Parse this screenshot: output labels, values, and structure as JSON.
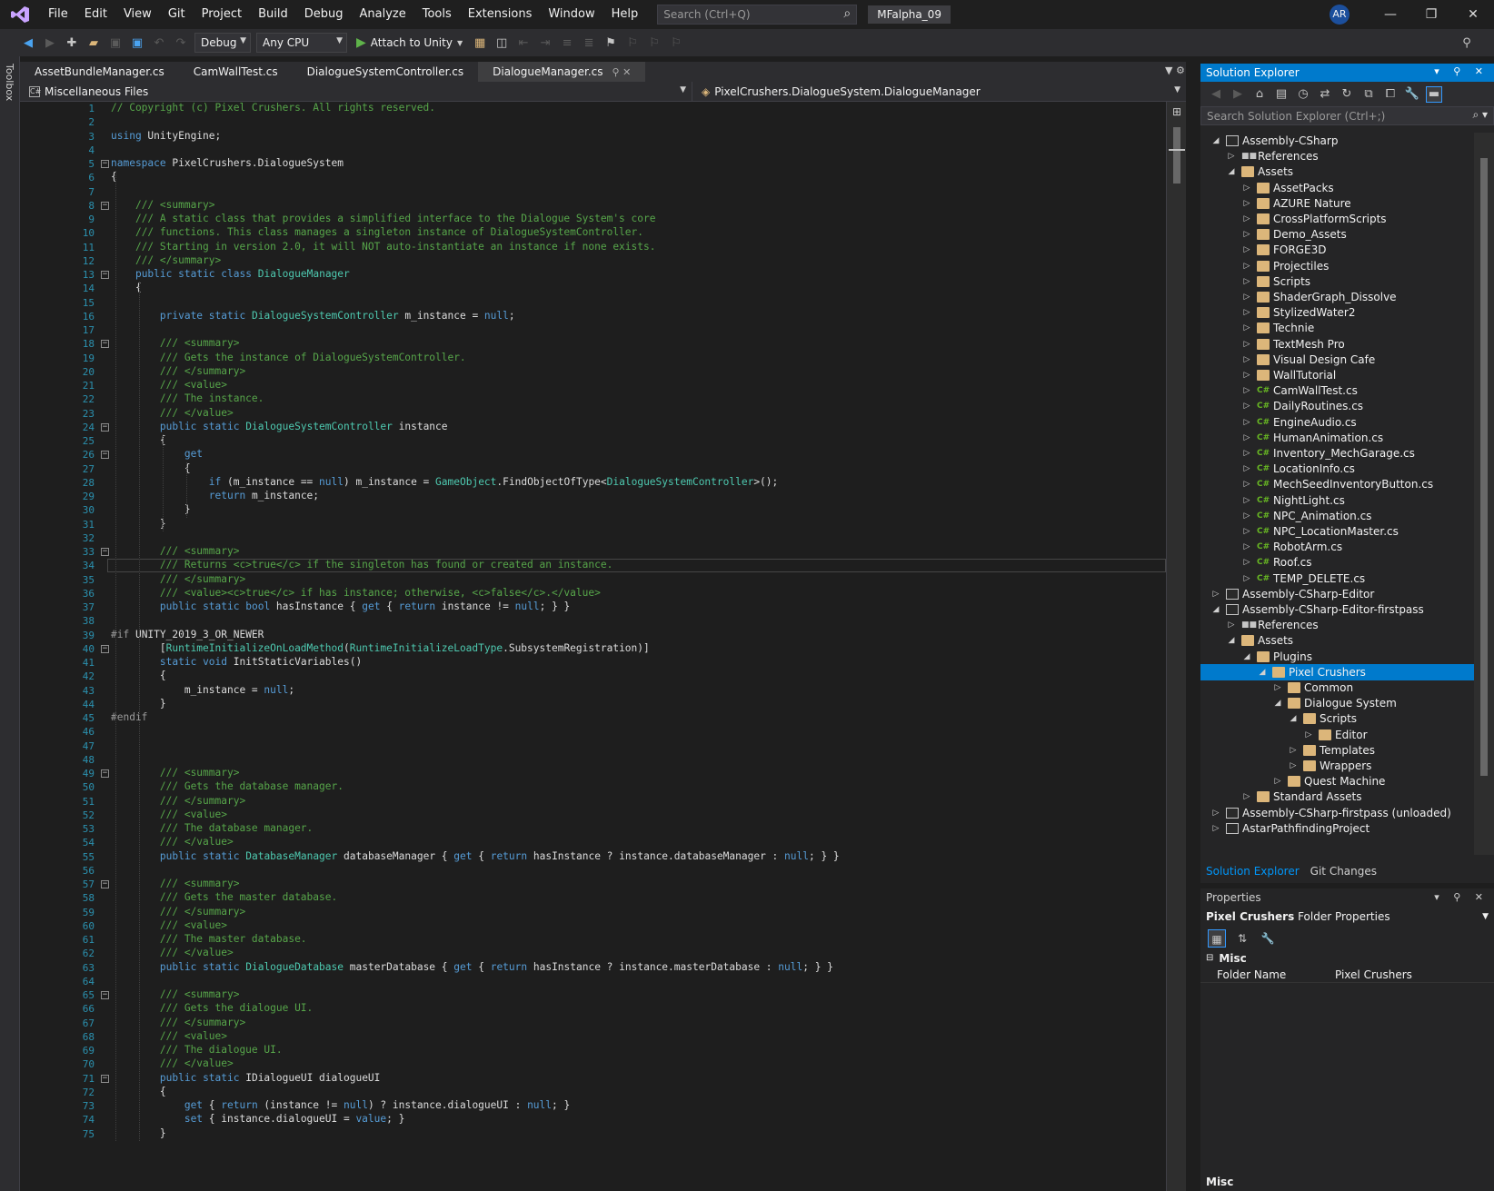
{
  "menubar": {
    "items": [
      "File",
      "Edit",
      "View",
      "Git",
      "Project",
      "Build",
      "Debug",
      "Analyze",
      "Tools",
      "Extensions",
      "Window",
      "Help"
    ],
    "search_placeholder": "Search (Ctrl+Q)",
    "solution_name": "MFalpha_09",
    "user_initials": "AR"
  },
  "toolbar": {
    "config": "Debug",
    "platform": "Any CPU",
    "attach_label": "Attach to Unity"
  },
  "toolbox_label": "Toolbox",
  "tabs": [
    {
      "label": "AssetBundleManager.cs",
      "active": false
    },
    {
      "label": "CamWallTest.cs",
      "active": false
    },
    {
      "label": "DialogueSystemController.cs",
      "active": false
    },
    {
      "label": "DialogueManager.cs",
      "active": true
    }
  ],
  "navbar": {
    "project": "Miscellaneous Files",
    "type": "PixelCrushers.DialogueSystem.DialogueManager"
  },
  "code_lines": [
    "// Copyright (c) Pixel Crushers. All rights reserved.",
    "",
    "using UnityEngine;",
    "",
    "namespace PixelCrushers.DialogueSystem",
    "{",
    "",
    "    /// <summary>",
    "    /// A static class that provides a simplified interface to the Dialogue System's core",
    "    /// functions. This class manages a singleton instance of DialogueSystemController.",
    "    /// Starting in version 2.0, it will NOT auto-instantiate an instance if none exists.",
    "    /// </summary>",
    "    public static class DialogueManager",
    "    {",
    "",
    "        private static DialogueSystemController m_instance = null;",
    "",
    "        /// <summary>",
    "        /// Gets the instance of DialogueSystemController.",
    "        /// </summary>",
    "        /// <value>",
    "        /// The instance.",
    "        /// </value>",
    "        public static DialogueSystemController instance",
    "        {",
    "            get",
    "            {",
    "                if (m_instance == null) m_instance = GameObject.FindObjectOfType<DialogueSystemController>();",
    "                return m_instance;",
    "            }",
    "        }",
    "",
    "        /// <summary>",
    "        /// Returns <c>true</c> if the singleton has found or created an instance.",
    "        /// </summary>",
    "        /// <value><c>true</c> if has instance; otherwise, <c>false</c>.</value>",
    "        public static bool hasInstance { get { return instance != null; } }",
    "",
    "#if UNITY_2019_3_OR_NEWER",
    "        [RuntimeInitializeOnLoadMethod(RuntimeInitializeLoadType.SubsystemRegistration)]",
    "        static void InitStaticVariables()",
    "        {",
    "            m_instance = null;",
    "        }",
    "#endif",
    "",
    "",
    "",
    "        /// <summary>",
    "        /// Gets the database manager.",
    "        /// </summary>",
    "        /// <value>",
    "        /// The database manager.",
    "        /// </value>",
    "        public static DatabaseManager databaseManager { get { return hasInstance ? instance.databaseManager : null; } }",
    "",
    "        /// <summary>",
    "        /// Gets the master database.",
    "        /// </summary>",
    "        /// <value>",
    "        /// The master database.",
    "        /// </value>",
    "        public static DialogueDatabase masterDatabase { get { return hasInstance ? instance.masterDatabase : null; } }",
    "",
    "        /// <summary>",
    "        /// Gets the dialogue UI.",
    "        /// </summary>",
    "        /// <value>",
    "        /// The dialogue UI.",
    "        /// </value>",
    "        public static IDialogueUI dialogueUI",
    "        {",
    "            get { return (instance != null) ? instance.dialogueUI : null; }",
    "            set { instance.dialogueUI = value; }",
    "        }"
  ],
  "fold_lines": [
    5,
    8,
    13,
    18,
    24,
    26,
    33,
    40,
    49,
    57,
    65,
    71
  ],
  "current_line": 34,
  "solution_explorer": {
    "title": "Solution Explorer",
    "search_placeholder": "Search Solution Explorer (Ctrl+;)",
    "items": [
      {
        "label": "Assembly-CSharp",
        "level": 0,
        "icon": "proj",
        "exp": "open"
      },
      {
        "label": "References",
        "level": 1,
        "icon": "refs",
        "exp": "closed"
      },
      {
        "label": "Assets",
        "level": 1,
        "icon": "ofolder",
        "exp": "open"
      },
      {
        "label": "AssetPacks",
        "level": 2,
        "icon": "folder",
        "exp": "closed"
      },
      {
        "label": "AZURE Nature",
        "level": 2,
        "icon": "folder",
        "exp": "closed"
      },
      {
        "label": "CrossPlatformScripts",
        "level": 2,
        "icon": "folder",
        "exp": "closed"
      },
      {
        "label": "Demo_Assets",
        "level": 2,
        "icon": "folder",
        "exp": "closed"
      },
      {
        "label": "FORGE3D",
        "level": 2,
        "icon": "folder",
        "exp": "closed"
      },
      {
        "label": "Projectiles",
        "level": 2,
        "icon": "folder",
        "exp": "closed"
      },
      {
        "label": "Scripts",
        "level": 2,
        "icon": "folder",
        "exp": "closed"
      },
      {
        "label": "ShaderGraph_Dissolve",
        "level": 2,
        "icon": "folder",
        "exp": "closed"
      },
      {
        "label": "StylizedWater2",
        "level": 2,
        "icon": "folder",
        "exp": "closed"
      },
      {
        "label": "Technie",
        "level": 2,
        "icon": "folder",
        "exp": "closed"
      },
      {
        "label": "TextMesh Pro",
        "level": 2,
        "icon": "folder",
        "exp": "closed"
      },
      {
        "label": "Visual Design Cafe",
        "level": 2,
        "icon": "folder",
        "exp": "closed"
      },
      {
        "label": "WallTutorial",
        "level": 2,
        "icon": "folder",
        "exp": "closed"
      },
      {
        "label": "CamWallTest.cs",
        "level": 2,
        "icon": "cs",
        "exp": "closed"
      },
      {
        "label": "DailyRoutines.cs",
        "level": 2,
        "icon": "cs",
        "exp": "closed"
      },
      {
        "label": "EngineAudio.cs",
        "level": 2,
        "icon": "cs",
        "exp": "closed"
      },
      {
        "label": "HumanAnimation.cs",
        "level": 2,
        "icon": "cs",
        "exp": "closed"
      },
      {
        "label": "Inventory_MechGarage.cs",
        "level": 2,
        "icon": "cs",
        "exp": "closed"
      },
      {
        "label": "LocationInfo.cs",
        "level": 2,
        "icon": "cs",
        "exp": "closed"
      },
      {
        "label": "MechSeedInventoryButton.cs",
        "level": 2,
        "icon": "cs",
        "exp": "closed"
      },
      {
        "label": "NightLight.cs",
        "level": 2,
        "icon": "cs",
        "exp": "closed"
      },
      {
        "label": "NPC_Animation.cs",
        "level": 2,
        "icon": "cs",
        "exp": "closed"
      },
      {
        "label": "NPC_LocationMaster.cs",
        "level": 2,
        "icon": "cs",
        "exp": "closed"
      },
      {
        "label": "RobotArm.cs",
        "level": 2,
        "icon": "cs",
        "exp": "closed"
      },
      {
        "label": "Roof.cs",
        "level": 2,
        "icon": "cs",
        "exp": "closed"
      },
      {
        "label": "TEMP_DELETE.cs",
        "level": 2,
        "icon": "cs",
        "exp": "closed"
      },
      {
        "label": "Assembly-CSharp-Editor",
        "level": 0,
        "icon": "proj",
        "exp": "closed"
      },
      {
        "label": "Assembly-CSharp-Editor-firstpass",
        "level": 0,
        "icon": "proj",
        "exp": "open"
      },
      {
        "label": "References",
        "level": 1,
        "icon": "refs",
        "exp": "closed"
      },
      {
        "label": "Assets",
        "level": 1,
        "icon": "ofolder",
        "exp": "open"
      },
      {
        "label": "Plugins",
        "level": 2,
        "icon": "ofolder",
        "exp": "open"
      },
      {
        "label": "Pixel Crushers",
        "level": 3,
        "icon": "ofolder",
        "exp": "open",
        "selected": true
      },
      {
        "label": "Common",
        "level": 4,
        "icon": "folder",
        "exp": "closed"
      },
      {
        "label": "Dialogue System",
        "level": 4,
        "icon": "ofolder",
        "exp": "open"
      },
      {
        "label": "Scripts",
        "level": 5,
        "icon": "ofolder",
        "exp": "open"
      },
      {
        "label": "Editor",
        "level": 6,
        "icon": "folder",
        "exp": "closed"
      },
      {
        "label": "Templates",
        "level": 5,
        "icon": "folder",
        "exp": "closed"
      },
      {
        "label": "Wrappers",
        "level": 5,
        "icon": "folder",
        "exp": "closed"
      },
      {
        "label": "Quest Machine",
        "level": 4,
        "icon": "folder",
        "exp": "closed"
      },
      {
        "label": "Standard Assets",
        "level": 2,
        "icon": "folder",
        "exp": "closed"
      },
      {
        "label": "Assembly-CSharp-firstpass (unloaded)",
        "level": 0,
        "icon": "proj",
        "exp": "closed"
      },
      {
        "label": "AstarPathfindingProject",
        "level": 0,
        "icon": "proj",
        "exp": "closed"
      }
    ],
    "bottom_tabs": [
      "Solution Explorer",
      "Git Changes"
    ]
  },
  "properties": {
    "title": "Properties",
    "object_name": "Pixel Crushers",
    "object_type": "Folder Properties",
    "category": "Misc",
    "row_name": "Folder Name",
    "row_value": "Pixel Crushers",
    "footer": "Misc"
  },
  "colors": {
    "accent": "#007acc",
    "editor_bg": "#1e1e1e",
    "keyword": "#569cd6",
    "comment": "#57a64a",
    "type": "#4ec9b0",
    "line_number": "#2b91af"
  }
}
